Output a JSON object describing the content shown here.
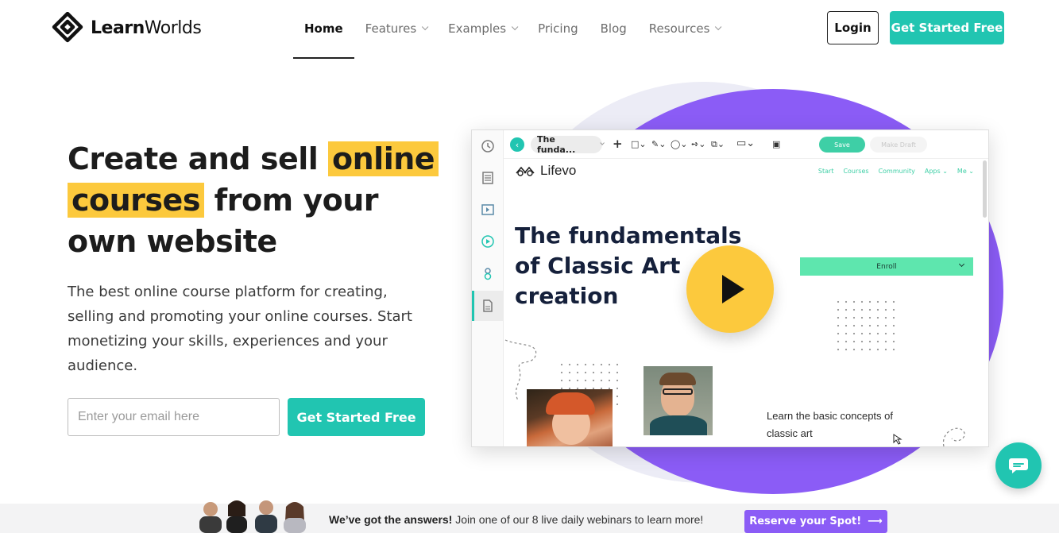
{
  "brand": {
    "name_bold": "Learn",
    "name_rest": "Worlds"
  },
  "nav": {
    "items": [
      {
        "label": "Home",
        "active": true,
        "dropdown": false
      },
      {
        "label": "Features",
        "active": false,
        "dropdown": true
      },
      {
        "label": "Examples",
        "active": false,
        "dropdown": true
      },
      {
        "label": "Pricing",
        "active": false,
        "dropdown": false
      },
      {
        "label": "Blog",
        "active": false,
        "dropdown": false
      },
      {
        "label": "Resources",
        "active": false,
        "dropdown": true
      }
    ],
    "login_label": "Login",
    "cta_label": "Get Started Free"
  },
  "hero": {
    "title_part1": "Create and sell ",
    "title_highlight1": "online",
    "title_highlight2": "courses",
    "title_part2": " from your own website",
    "subtitle": "The best online course platform for creating, selling and promoting your online courses. Start monetizing your skills, experiences and your audience.",
    "email_placeholder": "Enter your email here",
    "cta_label": "Get Started Free"
  },
  "app_preview": {
    "toolbar": {
      "page_name": "The funda...",
      "save_label": "Save",
      "draft_label": "Make Draft"
    },
    "site": {
      "logo_text": "Lifevo",
      "nav": [
        "Start",
        "Courses",
        "Community",
        "Apps ⌄",
        "Me ⌄"
      ]
    },
    "course_title": "The fundamentals of Classic Art creation",
    "enroll_label": "Enroll",
    "learn_text": "Learn the basic concepts of classic art"
  },
  "banner": {
    "bold": "We’ve got the answers!",
    "text": " Join one of our 8 live daily webinars to learn more!",
    "button_label": "Reserve your Spot!",
    "button_arrow": "⟶"
  },
  "colors": {
    "teal": "#21c5b1",
    "yellow": "#fcc93d",
    "purple": "#8b5cf6",
    "enroll_green": "#5ee6ae"
  }
}
